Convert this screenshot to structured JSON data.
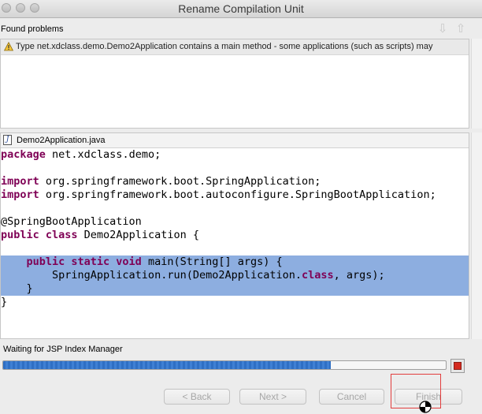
{
  "window": {
    "title": "Rename Compilation Unit"
  },
  "problems": {
    "header": "Found problems",
    "items": [
      {
        "icon": "warning-icon",
        "text": "Type net.xdclass.demo.Demo2Application contains a main method - some applications (such as scripts) may"
      }
    ]
  },
  "source": {
    "file_name": "Demo2Application.java",
    "lines": [
      {
        "parts": [
          {
            "t": "package",
            "kw": true
          },
          {
            "t": " net.xdclass.demo;"
          }
        ],
        "selected": false
      },
      {
        "parts": [
          {
            "t": ""
          }
        ],
        "selected": false
      },
      {
        "parts": [
          {
            "t": "import",
            "kw": true
          },
          {
            "t": " org.springframework.boot.SpringApplication;"
          }
        ],
        "selected": false
      },
      {
        "parts": [
          {
            "t": "import",
            "kw": true
          },
          {
            "t": " org.springframework.boot.autoconfigure.SpringBootApplication;"
          }
        ],
        "selected": false
      },
      {
        "parts": [
          {
            "t": ""
          }
        ],
        "selected": false
      },
      {
        "parts": [
          {
            "t": "@SpringBootApplication"
          }
        ],
        "selected": false
      },
      {
        "parts": [
          {
            "t": "public class",
            "kw": true
          },
          {
            "t": " Demo2Application {"
          }
        ],
        "selected": false
      },
      {
        "parts": [
          {
            "t": ""
          }
        ],
        "selected": false
      },
      {
        "parts": [
          {
            "t": "    "
          },
          {
            "t": "public static void",
            "kw": true
          },
          {
            "t": " main(String[] args) {"
          }
        ],
        "selected": true
      },
      {
        "parts": [
          {
            "t": "        SpringApplication.run(Demo2Application."
          },
          {
            "t": "class",
            "kw": true
          },
          {
            "t": ", args);"
          }
        ],
        "selected": true
      },
      {
        "parts": [
          {
            "t": "    }"
          }
        ],
        "selected": true
      },
      {
        "parts": [
          {
            "t": "}"
          }
        ],
        "selected": false
      }
    ]
  },
  "progress": {
    "label": "Waiting for JSP Index Manager",
    "fraction": 0.74
  },
  "buttons": {
    "back": "< Back",
    "next": "Next >",
    "cancel": "Cancel",
    "finish": "Finish"
  },
  "colors": {
    "selection": "#8daee0",
    "keyword": "#7f0055",
    "progress": "#2f6fc4",
    "stop": "#d42a1f",
    "focus_outline": "#e23d3d"
  }
}
